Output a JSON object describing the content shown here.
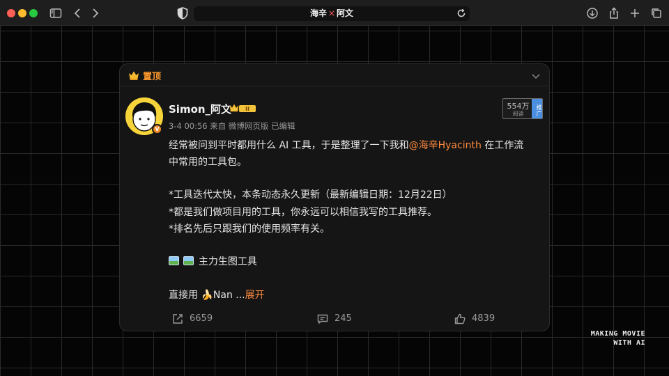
{
  "browser": {
    "title_left": "海辛",
    "title_sep": "×",
    "title_right": "阿文"
  },
  "card": {
    "pin_label": "置顶",
    "author": {
      "name": "Simon_阿文",
      "timestamp": "3-4 00:56",
      "source": "来自 微博网页版",
      "edited": "已编辑",
      "badge_level": "II"
    },
    "views": {
      "count": "554万",
      "label": "阅读",
      "promo_label": "推广"
    },
    "lines": {
      "l1_a": "经常被问到平时都用什么 AI 工具，于是整理了一下我和",
      "l1_mention": "@海辛Hyacinth",
      "l1_b": " 在工作流",
      "l2": "中常用的工具包。",
      "l3": "*工具迭代太快，本条动态永久更新（最新编辑日期：12月22日）",
      "l4": "*都是我们做项目用的工具，你永远可以相信我写的工具推荐。",
      "l5": "*排名先后只跟我们的使用频率有关。",
      "l6": "主力生图工具",
      "l7_a": "直接用 ",
      "l7_emoji": "🍌",
      "l7_b": "Nan  ...",
      "l7_expand": "展开"
    },
    "actions": {
      "share_count": "6659",
      "comment_count": "245",
      "like_count": "4839"
    }
  },
  "watermark": {
    "line1": "MAKING MOVIE",
    "line2": "WITH AI"
  },
  "colors": {
    "accent_orange": "#ff8a3d",
    "avatar_yellow": "#f7d43a",
    "promo_blue": "#4a8fe0"
  }
}
